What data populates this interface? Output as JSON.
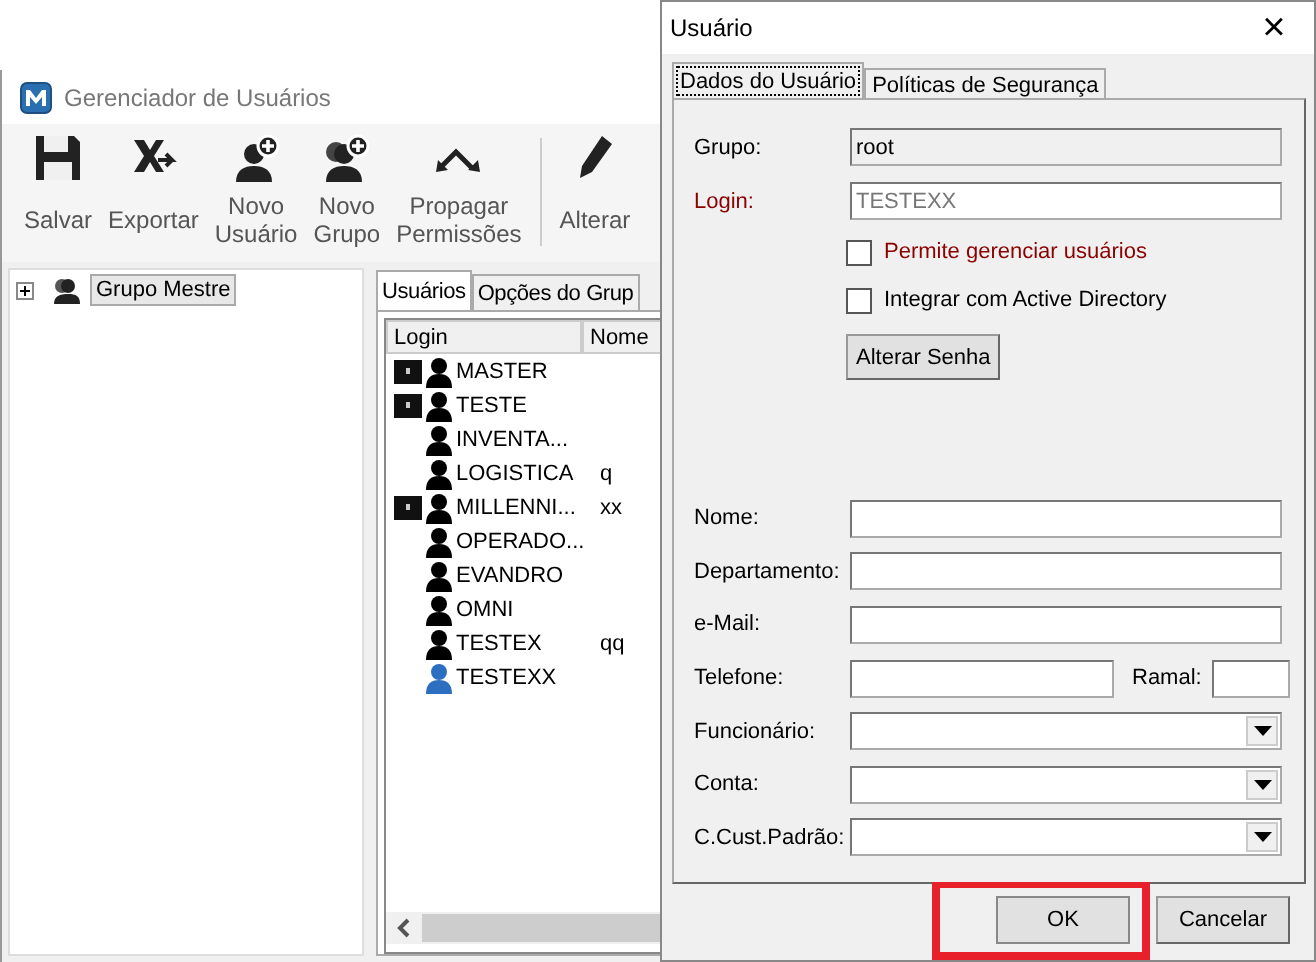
{
  "main_window": {
    "title": "Gerenciador de Usuários",
    "toolbar": [
      {
        "kind": "save",
        "label": "Salvar"
      },
      {
        "kind": "export",
        "label": "Exportar"
      },
      {
        "kind": "new_user",
        "label": "Novo\nUsuário"
      },
      {
        "kind": "new_group",
        "label": "Novo\nGrupo"
      },
      {
        "kind": "propagate",
        "label": "Propagar\nPermissões"
      },
      {
        "kind": "separator"
      },
      {
        "kind": "edit",
        "label": "Alterar"
      }
    ],
    "tree": [
      {
        "label": "Grupo Mestre",
        "expanded": false,
        "selected": true
      }
    ],
    "tabs": [
      {
        "label": "Usuários",
        "selected": true
      },
      {
        "label": "Opções do Grup",
        "selected": false
      }
    ],
    "columns": [
      "Login",
      "Nome"
    ],
    "users": [
      {
        "login": "MASTER",
        "admin": true,
        "selected": false
      },
      {
        "login": "TESTE",
        "admin": true,
        "selected": false
      },
      {
        "login": "INVENTA...",
        "admin": false,
        "selected": false
      },
      {
        "login": "LOGISTICA",
        "nome": "q",
        "admin": false,
        "selected": false
      },
      {
        "login": "MILLENNI...",
        "nome": "xx",
        "admin": true,
        "selected": false
      },
      {
        "login": "OPERADO...",
        "admin": false,
        "selected": false
      },
      {
        "login": "EVANDRO",
        "admin": false,
        "selected": false
      },
      {
        "login": "OMNI",
        "admin": false,
        "selected": false
      },
      {
        "login": "TESTEX",
        "nome": "qq",
        "admin": false,
        "selected": false
      },
      {
        "login": "TESTEXX",
        "admin": false,
        "selected": true
      }
    ]
  },
  "dialog": {
    "title": "Usuário",
    "close": "×",
    "tabs": [
      {
        "label": "Dados do Usuário",
        "selected": true
      },
      {
        "label": "Políticas de Segurança",
        "selected": false
      }
    ],
    "top_fields": [
      {
        "label": "Grupo:",
        "value": "root",
        "kind": "readonly",
        "emphasis": false
      },
      {
        "label": "Login:",
        "value": "TESTEXX",
        "kind": "locked",
        "emphasis": true
      }
    ],
    "checkboxes": [
      {
        "label": "Permite gerenciar usuários",
        "checked": false,
        "emphasis": true
      },
      {
        "label": "Integrar com Active Directory",
        "checked": false,
        "emphasis": false
      }
    ],
    "password_button": "Alterar Senha",
    "fields": [
      {
        "label": "Nome:",
        "kind": "text"
      },
      {
        "label": "Departamento:",
        "kind": "text"
      },
      {
        "label": "e-Mail:",
        "kind": "text"
      },
      {
        "label": "Telefone:",
        "kind": "phone",
        "extra_label": "Ramal:"
      },
      {
        "label": "Funcionário:",
        "kind": "combo"
      },
      {
        "label": "Conta:",
        "kind": "combo"
      },
      {
        "label": "C.Cust.Padrão:",
        "kind": "combo"
      }
    ],
    "buttons": [
      {
        "label": "OK",
        "highlighted": true
      },
      {
        "label": "Cancelar",
        "highlighted": false
      }
    ]
  }
}
